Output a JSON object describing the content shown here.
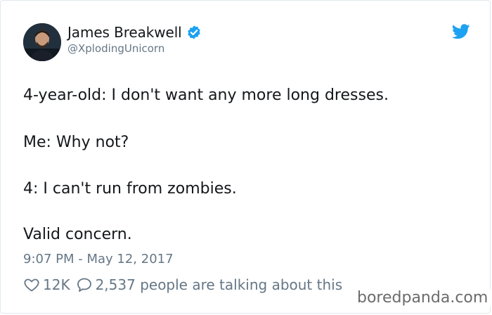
{
  "author": {
    "display_name": "James Breakwell",
    "handle": "@XplodingUnicorn",
    "verified": true
  },
  "tweet": {
    "lines": [
      "4-year-old: I don't want any more long dresses.",
      "Me: Why not?",
      "4: I can't run from zombies.",
      "Valid concern."
    ],
    "timestamp": "9:07 PM - May 12, 2017"
  },
  "engagement": {
    "likes": "12K",
    "replies_text": "2,537 people are talking about this"
  },
  "watermark": "boredpanda.com",
  "icons": {
    "verified": "verified-badge-icon",
    "brand": "twitter-bird-icon",
    "like": "heart-icon",
    "reply": "speech-bubble-icon"
  },
  "colors": {
    "accent": "#1da1f2",
    "text": "#14171a",
    "muted": "#657786",
    "border": "#e1e8ed"
  }
}
